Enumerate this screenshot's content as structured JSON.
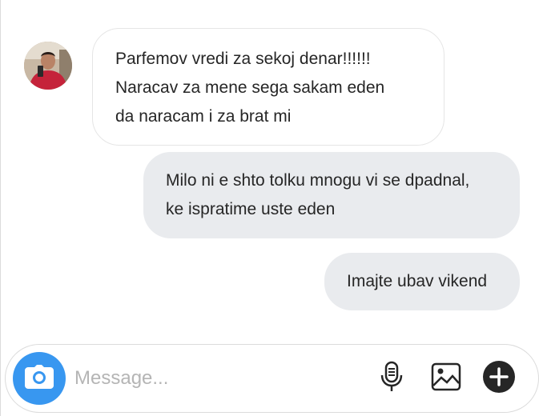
{
  "conversation": {
    "incoming": {
      "lines": [
        "Parfemov vredi za sekoj denar!!!!!!",
        "Naracav za mene sega sakam eden",
        "da naracam i za brat mi"
      ]
    },
    "outgoing": [
      {
        "lines": [
          "Milo ni e shto tolku mnogu vi se dpadnal,",
          "ke ispratime uste eden"
        ]
      },
      {
        "lines": [
          "Imajte ubav vikend"
        ]
      }
    ]
  },
  "composer": {
    "placeholder": "Message...",
    "value": ""
  },
  "icons": {
    "camera": "camera-icon",
    "microphone": "microphone-icon",
    "image": "image-icon",
    "add": "plus-circle-icon"
  },
  "colors": {
    "camera_button": "#3897f0",
    "outgoing_bubble": "#e9ebee",
    "incoming_bubble_border": "#e5e5e5",
    "placeholder": "#b5b5b5",
    "text": "#262626"
  }
}
